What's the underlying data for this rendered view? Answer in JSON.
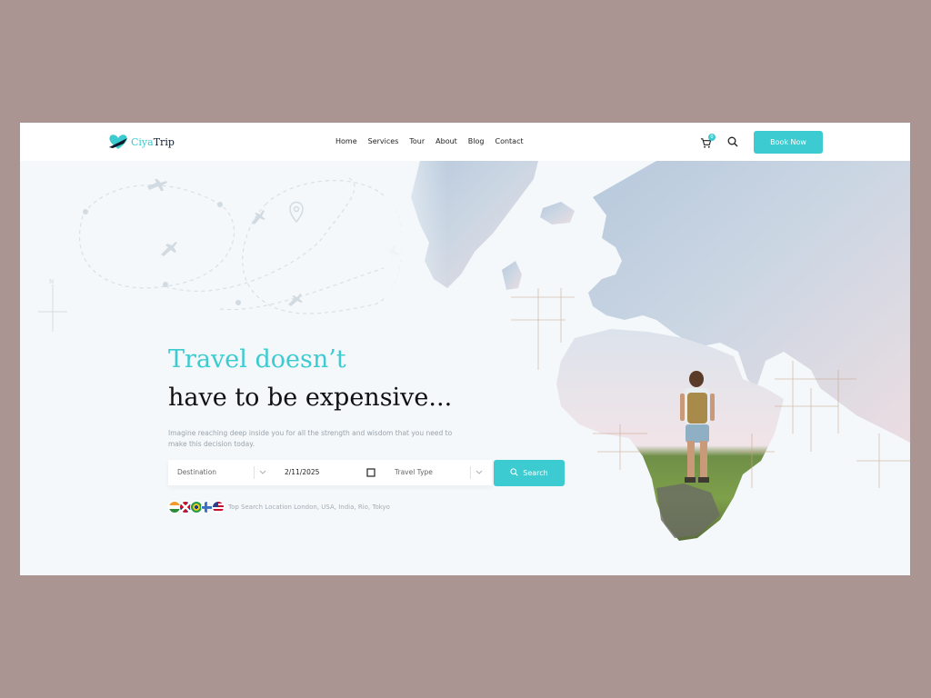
{
  "brand": {
    "part1": "Ciya",
    "part2": "Trip"
  },
  "nav": [
    "Home",
    "Services",
    "Tour",
    "About",
    "Blog",
    "Contact"
  ],
  "cart_count": "0",
  "book_label": "Book Now",
  "hero": {
    "title_line1": "Travel doesn’t",
    "title_line2": "have to be expensive...",
    "description": "Imagine reaching deep inside you for all the strength and wisdom that you need to make this decision today."
  },
  "search": {
    "destination_placeholder": "Destination",
    "date_value": "2/11/2025",
    "type_placeholder": "Travel Type",
    "button_label": "Search"
  },
  "top_search_text": "Top Search Location London, USA, India, Rio, Tokyo",
  "flags": [
    "india-flag-icon",
    "uk-flag-icon",
    "brazil-flag-icon",
    "finland-flag-icon",
    "usa-flag-icon"
  ],
  "colors": {
    "accent": "#3ccbd0",
    "dark": "#111111",
    "background": "#ab9593",
    "panel": "#f4f8fb"
  }
}
